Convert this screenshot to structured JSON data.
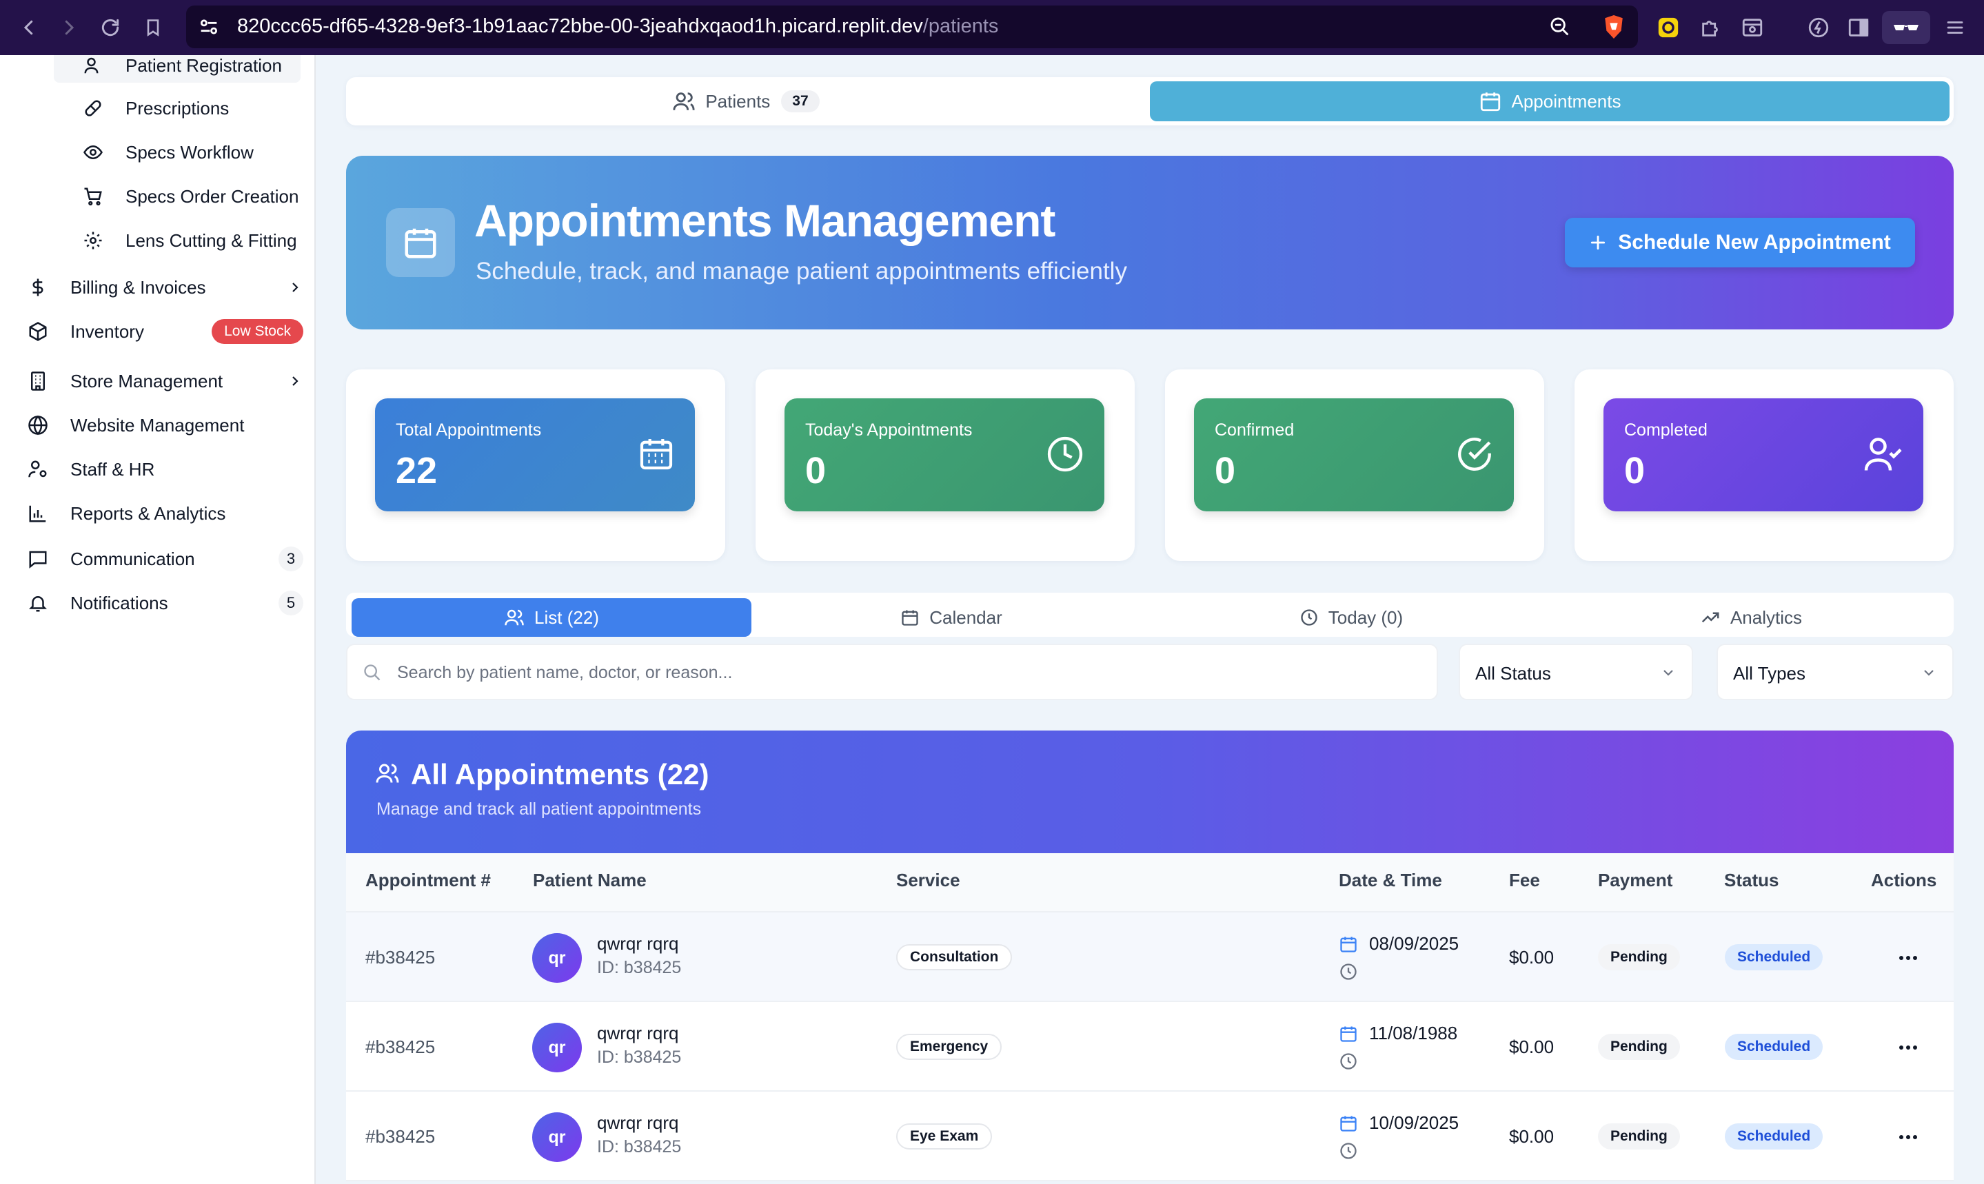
{
  "browser": {
    "url_main": "820ccc65-df65-4328-9ef3-1b91aac72bbe-00-3jeahdxqaod1h.picard.replit.dev",
    "url_path": "/patients"
  },
  "sidebar": {
    "sub_items": [
      {
        "label": "Patient Registration",
        "icon": "user-icon"
      },
      {
        "label": "Prescriptions",
        "icon": "pill-icon"
      },
      {
        "label": "Specs Workflow",
        "icon": "eye-icon"
      },
      {
        "label": "Specs Order Creation",
        "icon": "cart-icon"
      },
      {
        "label": "Lens Cutting & Fitting",
        "icon": "gear-icon"
      }
    ],
    "items": [
      {
        "label": "Billing & Invoices",
        "icon": "dollar-icon"
      },
      {
        "label": "Inventory",
        "icon": "box-icon",
        "badge": "Low Stock"
      },
      {
        "label": "Store Management",
        "icon": "building-icon"
      },
      {
        "label": "Website Management",
        "icon": "globe-icon"
      },
      {
        "label": "Staff & HR",
        "icon": "user-cog-icon"
      },
      {
        "label": "Reports & Analytics",
        "icon": "bar-chart-icon"
      },
      {
        "label": "Communication",
        "icon": "message-icon",
        "badge": "3"
      },
      {
        "label": "Notifications",
        "icon": "bell-icon",
        "badge": "5"
      }
    ]
  },
  "top_tabs": {
    "patients_label": "Patients",
    "patients_count": "37",
    "appointments_label": "Appointments"
  },
  "hero": {
    "title": "Appointments Management",
    "subtitle": "Schedule, track, and manage patient appointments efficiently",
    "button_label": "Schedule New Appointment"
  },
  "stats": [
    {
      "label": "Total Appointments",
      "value": "22",
      "icon": "calendar-grid-icon",
      "color": "#3b7fd9"
    },
    {
      "label": "Today's Appointments",
      "value": "0",
      "icon": "clock-icon",
      "color": "#3c9f72"
    },
    {
      "label": "Confirmed",
      "value": "0",
      "icon": "check-circle-icon",
      "color": "#3c9f72"
    },
    {
      "label": "Completed",
      "value": "0",
      "icon": "user-check-icon",
      "color": "#6f44e0"
    }
  ],
  "view_tabs": [
    {
      "label": "List (22)",
      "icon": "users-icon"
    },
    {
      "label": "Calendar",
      "icon": "calendar-icon"
    },
    {
      "label": "Today (0)",
      "icon": "clock-icon"
    },
    {
      "label": "Analytics",
      "icon": "trend-icon"
    }
  ],
  "filters": {
    "search_placeholder": "Search by patient name, doctor, or reason...",
    "status_value": "All Status",
    "type_value": "All Types"
  },
  "table": {
    "title": "All Appointments (22)",
    "subtitle": "Manage and track all patient appointments",
    "headers": [
      "Appointment #",
      "Patient Name",
      "Service",
      "Date & Time",
      "Fee",
      "Payment",
      "Status",
      "Actions"
    ],
    "rows": [
      {
        "number": "#b38425",
        "initials": "qr",
        "name": "qwrqr rqrq",
        "pid": "ID: b38425",
        "service": "Consultation",
        "date": "08/09/2025",
        "fee": "$0.00",
        "payment": "Pending",
        "status": "Scheduled"
      },
      {
        "number": "#b38425",
        "initials": "qr",
        "name": "qwrqr rqrq",
        "pid": "ID: b38425",
        "service": "Emergency",
        "date": "11/08/1988",
        "fee": "$0.00",
        "payment": "Pending",
        "status": "Scheduled"
      },
      {
        "number": "#b38425",
        "initials": "qr",
        "name": "qwrqr rqrq",
        "pid": "ID: b38425",
        "service": "Eye Exam",
        "date": "10/09/2025",
        "fee": "$0.00",
        "payment": "Pending",
        "status": "Scheduled"
      }
    ]
  }
}
